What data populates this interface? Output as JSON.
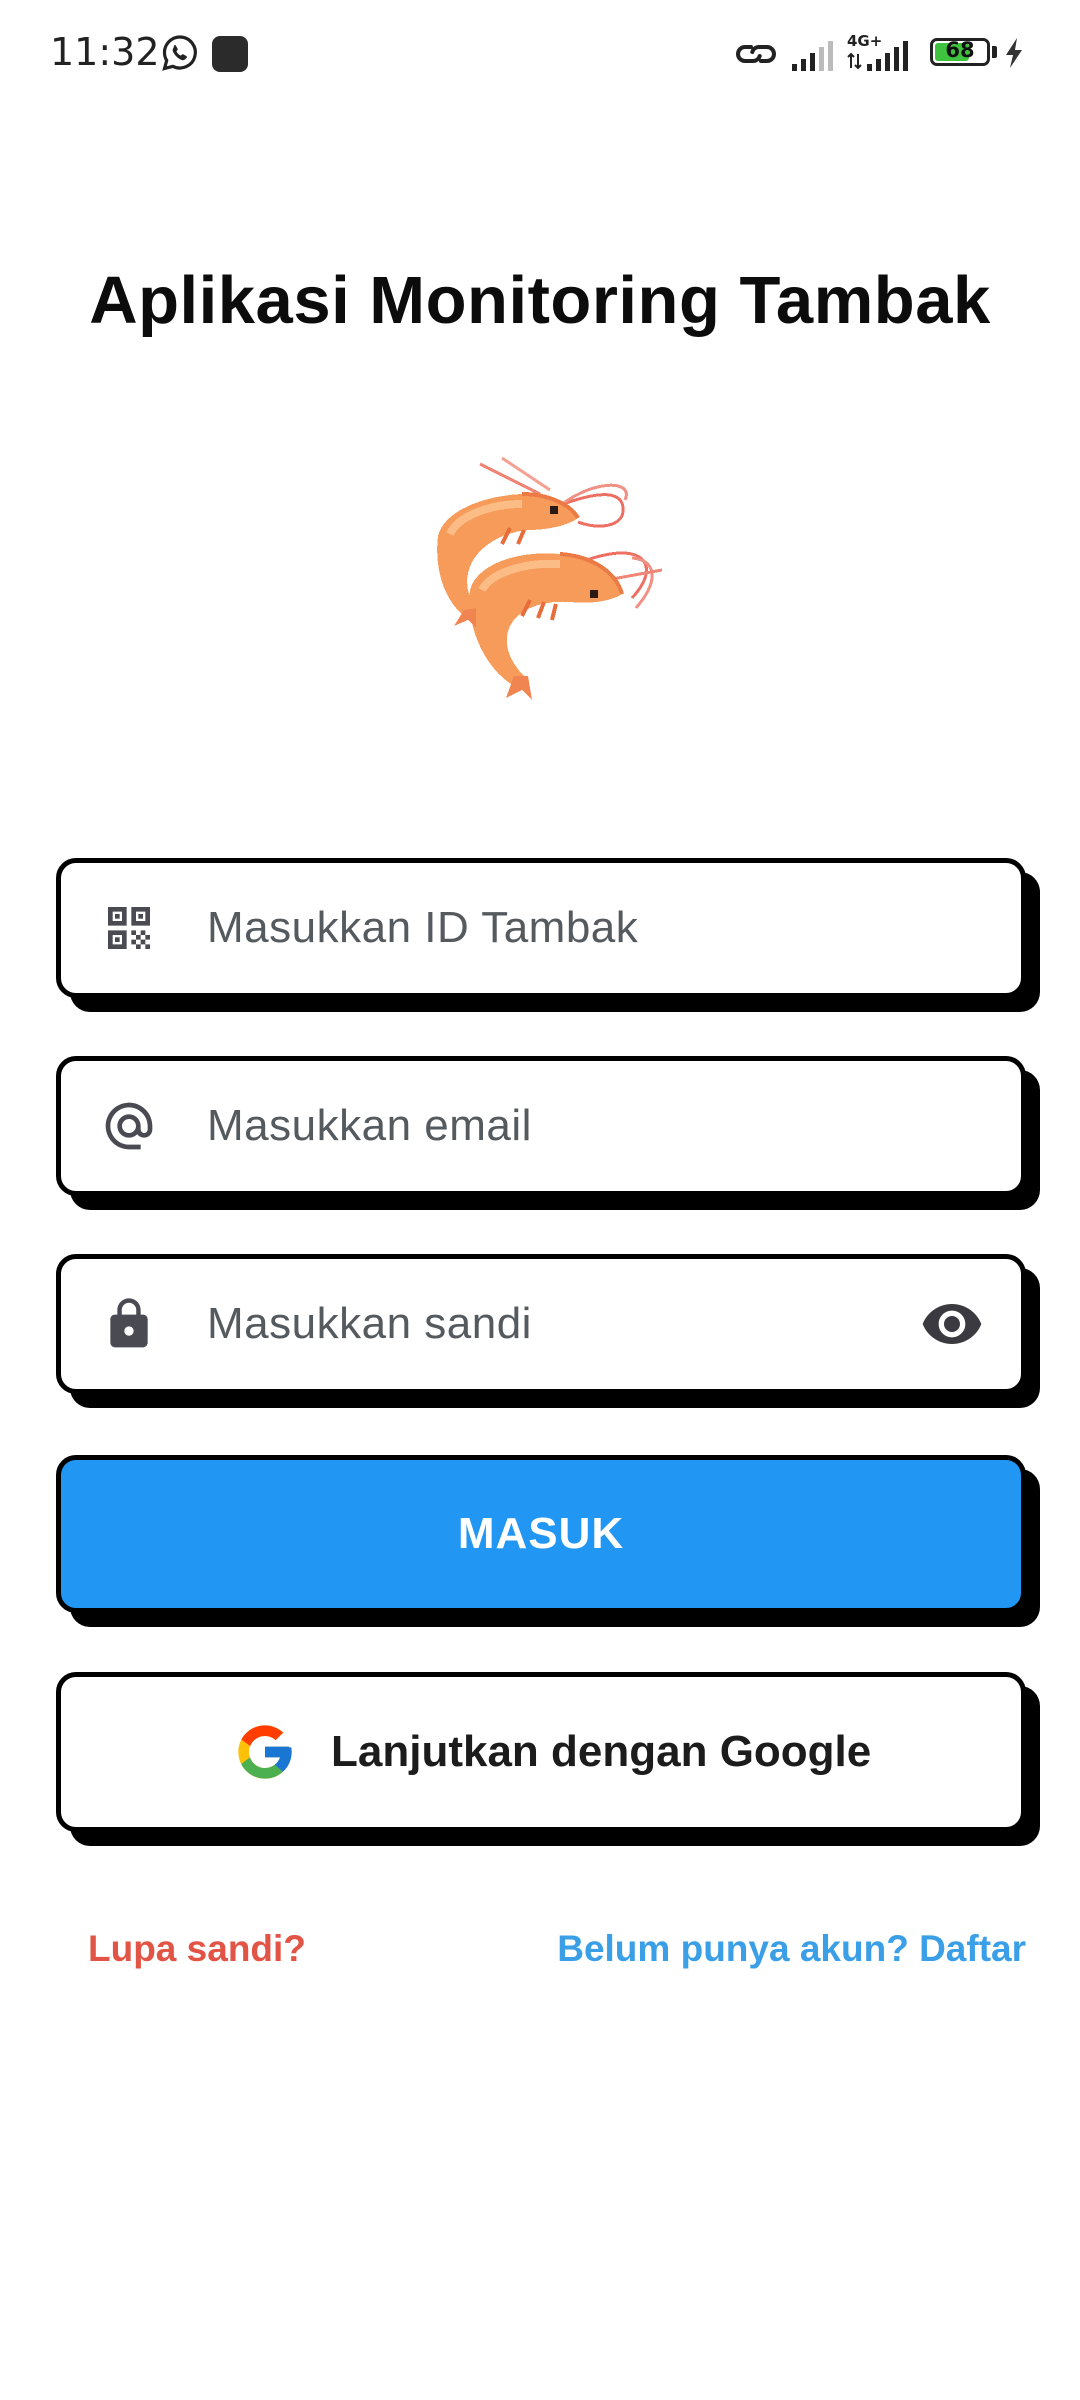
{
  "status_bar": {
    "time": "11:32",
    "network_label": "4G+",
    "battery_level": "68",
    "battery_fraction": 0.68,
    "icons": [
      "whatsapp-icon",
      "app-notification-icon",
      "link-icon",
      "signal-icon",
      "signal-4g-icon",
      "battery-icon",
      "charging-icon"
    ]
  },
  "header": {
    "title": "Aplikasi Monitoring Tambak"
  },
  "logo": {
    "icon": "shrimp-logo"
  },
  "form": {
    "farm_id": {
      "placeholder": "Masukkan ID Tambak",
      "value": "",
      "icon": "qr-code-icon"
    },
    "email": {
      "placeholder": "Masukkan email",
      "value": "",
      "icon": "at-sign-icon"
    },
    "password": {
      "placeholder": "Masukkan sandi",
      "value": "",
      "icon": "lock-icon",
      "toggle_icon": "eye-icon"
    }
  },
  "buttons": {
    "login_label": "MASUK",
    "google_label": "Lanjutkan dengan Google"
  },
  "links": {
    "forgot_password": "Lupa sandi?",
    "register": "Belum punya akun? Daftar"
  },
  "colors": {
    "primary": "#2196f3",
    "forgot_link": "#e25445",
    "register_link": "#3a9fe6",
    "border": "#000000",
    "battery_fill": "#3fc33f"
  }
}
